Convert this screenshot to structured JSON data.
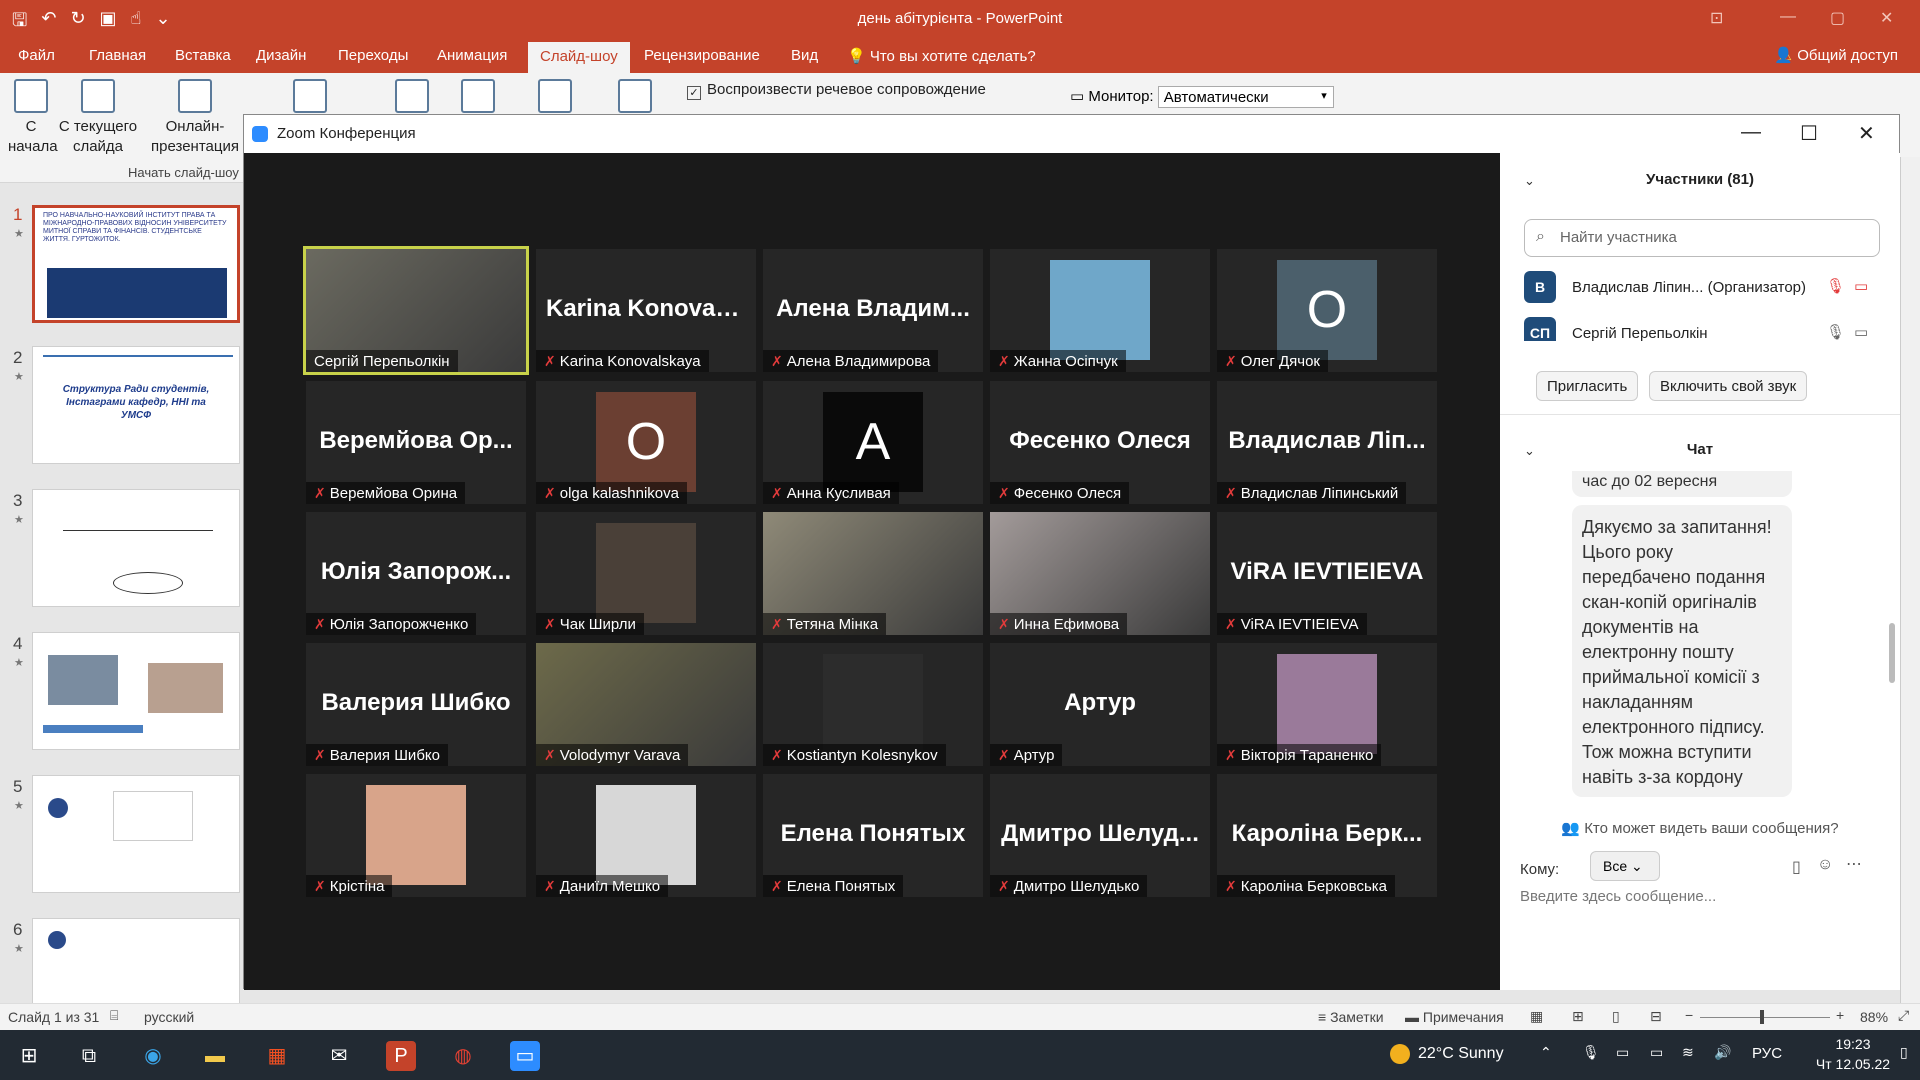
{
  "window": {
    "title": "день абітурієнта - PowerPoint"
  },
  "ribbon_tabs": [
    "Файл",
    "Главная",
    "Вставка",
    "Дизайн",
    "Переходы",
    "Анимация",
    "Слайд-шоу",
    "Рецензирование",
    "Вид",
    "Что вы хотите сделать?"
  ],
  "share_label": "Общий доступ",
  "ribbon": {
    "btn_start": "С начала",
    "btn_current": "С текущего слайда",
    "btn_online": "Онлайн-презентация",
    "group_label": "Начать слайд-шоу",
    "check_voice": "Воспроизвести речевое сопровождение",
    "check_voice_checked": true,
    "monitor_label": "Монитор:",
    "monitor_value": "Автоматически"
  },
  "slides": [
    {
      "num": "1",
      "text": "ПРО НАВЧАЛЬНО-НАУКОВИЙ ІНСТИТУТ ПРАВА ТА МІЖНАРОДНО-ПРАВОВИХ ВІДНОСИН УНІВЕРСИТЕТУ МИТНОЇ СПРАВИ ТА ФІНАНСІВ. СТУДЕНТСЬКЕ ЖИТТЯ. ГУРТОЖИТОК."
    },
    {
      "num": "2",
      "text": "Структура Ради студентів, Інстаграми кафедр, ННІ та УМСФ"
    },
    {
      "num": "3",
      "text": ""
    },
    {
      "num": "4",
      "text": ""
    },
    {
      "num": "5",
      "text": ""
    },
    {
      "num": "6",
      "text": ""
    }
  ],
  "status": {
    "slide": "Слайд 1 из 31",
    "lang": "русский",
    "notes": "Заметки",
    "comments": "Примечания",
    "zoom": "88%"
  },
  "zoom": {
    "title": "Zoom Конференция",
    "participants_title": "Участники (81)",
    "search_placeholder": "Найти участника",
    "participants": [
      {
        "initials": "В",
        "name": "Владислав Ліпин...  (Организатор)"
      },
      {
        "initials": "СП",
        "name": "Сергій Перепьолкін"
      }
    ],
    "invite": "Пригласить",
    "unmute": "Включить свой звук",
    "chat_title": "Чат",
    "chat_prev": "час до 02 вересня",
    "chat_msg": "Дякуємо за запитання! Цього року передбачено подання скан-копій оригіналів документів на електронну пошту приймальної комісії з накладанням електронного підпису. Тож можна вступити навіть з-за кордону",
    "who_can_see": "Кто может видеть ваши сообщения?",
    "to_label": "Кому:",
    "to_value": "Все",
    "input_placeholder": "Введите здесь сообщение..."
  },
  "tiles": [
    {
      "label": "Сергій Перепьолкін",
      "big": "",
      "kind": "video",
      "muted": false,
      "active": true,
      "color": "#6b6a60"
    },
    {
      "label": "Karina Konovalskaya",
      "big": "Karina  Konovals...",
      "kind": "name",
      "muted": true
    },
    {
      "label": "Алена Владимирова",
      "big": "Алена  Владим...",
      "kind": "name",
      "muted": true
    },
    {
      "label": "Жанна Осіпчук",
      "big": "",
      "kind": "photo",
      "muted": true,
      "color": "#6fa7c9"
    },
    {
      "label": "Олег Дячок",
      "big": "O",
      "kind": "avatar",
      "muted": true,
      "color": "#4b5f6b"
    },
    {
      "label": "Веремйова Орина",
      "big": "Веремйова  Ор...",
      "kind": "name",
      "muted": true
    },
    {
      "label": "olga kalashnikova",
      "big": "O",
      "kind": "avatar",
      "muted": true,
      "color": "#6b3f32"
    },
    {
      "label": "Анна Кусливая",
      "big": "А",
      "kind": "avatar",
      "muted": true,
      "color": "#0a0a0a"
    },
    {
      "label": "Фесенко Олеся",
      "big": "Фесенко Олеся",
      "kind": "name",
      "muted": true
    },
    {
      "label": "Владислав Ліпинський",
      "big": "Владислав  Ліп...",
      "kind": "name",
      "muted": true
    },
    {
      "label": "Юлія Запорожченко",
      "big": "Юлія  Запорож...",
      "kind": "name",
      "muted": true
    },
    {
      "label": "Чак Ширли",
      "big": "",
      "kind": "photo",
      "muted": true,
      "color": "#4a4038"
    },
    {
      "label": "Тетяна Мінка",
      "big": "",
      "kind": "video",
      "muted": true,
      "color": "#8f8a78"
    },
    {
      "label": "Инна Ефимова",
      "big": "",
      "kind": "video",
      "muted": true,
      "color": "#a39b9a"
    },
    {
      "label": "ViRA IEVTIEIEVA",
      "big": "ViRA IEVTIEIEVA",
      "kind": "name",
      "muted": true
    },
    {
      "label": "Валерия Шибко",
      "big": "Валерия Шибко",
      "kind": "name",
      "muted": true
    },
    {
      "label": "Volodymyr Varava",
      "big": "",
      "kind": "video",
      "muted": true,
      "color": "#6d6a4a"
    },
    {
      "label": "Kostiantyn Kolesnykov",
      "big": "",
      "kind": "photo",
      "muted": true,
      "color": "#2c2c2c"
    },
    {
      "label": "Артур",
      "big": "Артур",
      "kind": "name",
      "muted": true
    },
    {
      "label": "Вікторія Тараненко",
      "big": "",
      "kind": "photo",
      "muted": true,
      "color": "#9a7a9a"
    },
    {
      "label": "Крістіна",
      "big": "",
      "kind": "photo",
      "muted": true,
      "color": "#d8a48a"
    },
    {
      "label": "Даниїл Мешко",
      "big": "",
      "kind": "photo",
      "muted": true,
      "color": "#d7d7d7"
    },
    {
      "label": "Елена Понятых",
      "big": "Елена Понятых",
      "kind": "name",
      "muted": true
    },
    {
      "label": "Дмитро Шелудько",
      "big": "Дмитро  Шелуд...",
      "kind": "name",
      "muted": true
    },
    {
      "label": "Кароліна Берковська",
      "big": "Кароліна  Берк...",
      "kind": "name",
      "muted": true
    }
  ],
  "taskbar": {
    "weather": "22°C  Sunny",
    "lang": "РУС",
    "time": "19:23",
    "date": "Чт 12.05.22"
  }
}
